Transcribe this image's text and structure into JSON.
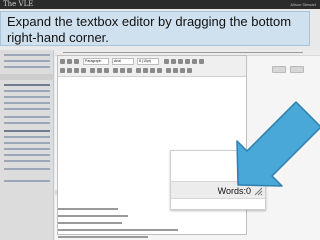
{
  "app": {
    "brand": "The VLE",
    "user": "Alison Stewart"
  },
  "caption": {
    "text": "Expand the textbox editor by dragging the bottom right-hand corner."
  },
  "toolbar": {
    "format_select": "Paragraph",
    "font_select": "Arial",
    "size_select": "8 (10pt)"
  },
  "editor": {
    "word_count": "Words:0"
  },
  "colors": {
    "caption_bg": "#cfe1ef",
    "arrow": "#4aa8d8",
    "topbar": "#2b2b2b"
  },
  "icons": [
    "resize-grip-icon",
    "arrow-pointer-icon"
  ]
}
